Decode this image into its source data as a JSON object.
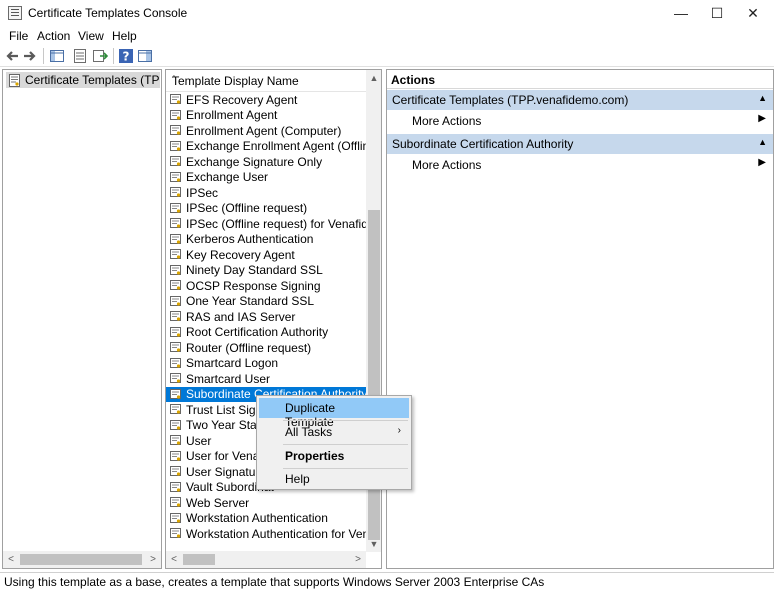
{
  "window": {
    "title": "Certificate Templates Console",
    "minimize_glyph": "—",
    "maximize_glyph": "☐",
    "close_glyph": "✕"
  },
  "menu": [
    "File",
    "Action",
    "View",
    "Help"
  ],
  "toolbar": {
    "icons": [
      "back-icon",
      "forward-icon",
      "show-tree-icon",
      "properties-icon",
      "export-list-icon",
      "help-icon",
      "show-action-pane-icon"
    ]
  },
  "tree": {
    "root_label": "Certificate Templates (TPP.vena"
  },
  "list": {
    "column_header": "Template Display Name",
    "items": [
      "EFS Recovery Agent",
      "Enrollment Agent",
      "Enrollment Agent (Computer)",
      "Exchange Enrollment Agent (Offline requ...",
      "Exchange Signature Only",
      "Exchange User",
      "IPSec",
      "IPSec (Offline request)",
      "IPSec (Offline request) for Venafidemo",
      "Kerberos Authentication",
      "Key Recovery Agent",
      "Ninety Day Standard SSL",
      "OCSP Response Signing",
      "One Year Standard SSL",
      "RAS and IAS Server",
      "Root Certification Authority",
      "Router (Offline request)",
      "Smartcard Logon",
      "Smartcard User",
      "Subordinate Certification Authority",
      "Trust List Signing",
      "Two Year Standa",
      "User",
      "User for Venafide",
      "User Signature O",
      "Vault Subordinat",
      "Web Server",
      "Workstation Authentication",
      "Workstation Authentication for Venafide..."
    ],
    "selected_index": 19
  },
  "actions": {
    "header": "Actions",
    "sections": [
      {
        "title": "Certificate Templates (TPP.venafidemo.com)",
        "item": "More Actions"
      },
      {
        "title": "Subordinate Certification Authority",
        "item": "More Actions"
      }
    ]
  },
  "context_menu": {
    "items": [
      {
        "label": "Duplicate Template"
      },
      {
        "label": "All Tasks"
      },
      {
        "label": "Properties"
      },
      {
        "label": "Help"
      }
    ]
  },
  "statusbar": {
    "text": "Using this template as a base, creates a template that supports Windows Server 2003 Enterprise CAs"
  },
  "colors": {
    "selection": "#0078d7",
    "action_section": "#c6d8ec",
    "menu_hover": "#91c9f7"
  }
}
